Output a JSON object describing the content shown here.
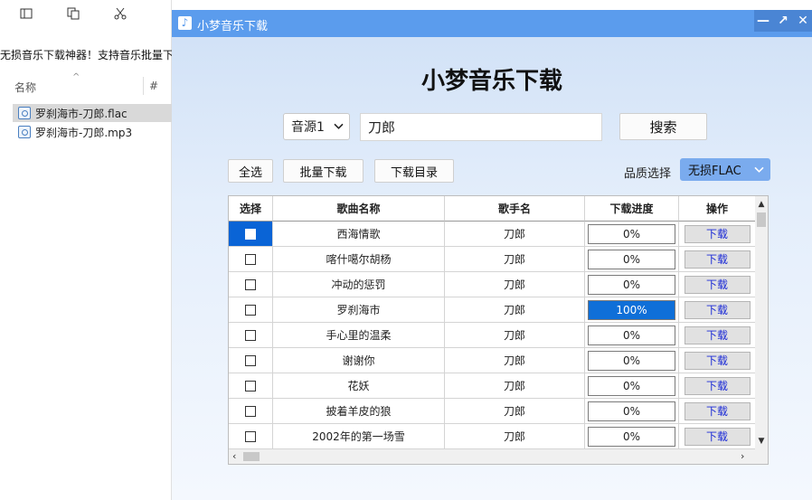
{
  "explorer": {
    "toolbar_icons": [
      "panel-icon",
      "copy-icon",
      "cut-icon"
    ],
    "banner_text": "无损音乐下载神器！支持音乐批量下",
    "column_name": "名称",
    "column_num": "#",
    "files": [
      {
        "name": "罗刹海市-刀郎.flac",
        "selected": true
      },
      {
        "name": "罗刹海市-刀郎.mp3",
        "selected": false
      }
    ]
  },
  "window": {
    "title": "小梦音乐下载",
    "icon": "music-note-icon",
    "controls": [
      "minimize-icon",
      "maximize-icon",
      "close-icon"
    ]
  },
  "main": {
    "heading": "小梦音乐下载",
    "source_select": "音源1",
    "search_value": "刀郎",
    "search_label": "搜索",
    "select_all_label": "全选",
    "batch_download_label": "批量下载",
    "download_dir_label": "下载目录",
    "quality_label": "品质选择",
    "quality_value": "无损FLAC"
  },
  "table": {
    "headers": [
      "选择",
      "歌曲名称",
      "歌手名",
      "下载进度",
      "操作"
    ],
    "rows": [
      {
        "song": "西海情歌",
        "artist": "刀郎",
        "progress": "0%",
        "progress_value": 0,
        "action": "下载",
        "row_selected": true
      },
      {
        "song": "喀什噶尔胡杨",
        "artist": "刀郎",
        "progress": "0%",
        "progress_value": 0,
        "action": "下载",
        "row_selected": false
      },
      {
        "song": "冲动的惩罚",
        "artist": "刀郎",
        "progress": "0%",
        "progress_value": 0,
        "action": "下载",
        "row_selected": false
      },
      {
        "song": "罗刹海市",
        "artist": "刀郎",
        "progress": "100%",
        "progress_value": 100,
        "action": "下载",
        "row_selected": false
      },
      {
        "song": "手心里的温柔",
        "artist": "刀郎",
        "progress": "0%",
        "progress_value": 0,
        "action": "下载",
        "row_selected": false
      },
      {
        "song": "谢谢你",
        "artist": "刀郎",
        "progress": "0%",
        "progress_value": 0,
        "action": "下载",
        "row_selected": false
      },
      {
        "song": "花妖",
        "artist": "刀郎",
        "progress": "0%",
        "progress_value": 0,
        "action": "下载",
        "row_selected": false
      },
      {
        "song": "披着羊皮的狼",
        "artist": "刀郎",
        "progress": "0%",
        "progress_value": 0,
        "action": "下载",
        "row_selected": false
      },
      {
        "song": "2002年的第一场雪",
        "artist": "刀郎",
        "progress": "0%",
        "progress_value": 0,
        "action": "下载",
        "row_selected": false
      }
    ]
  },
  "colors": {
    "titlebar": "#5b9ced",
    "selection": "#0a64d6",
    "progress_fill": "#0f6fd8",
    "quality_select": "#7aabee",
    "download_link": "#1c2bd6"
  }
}
